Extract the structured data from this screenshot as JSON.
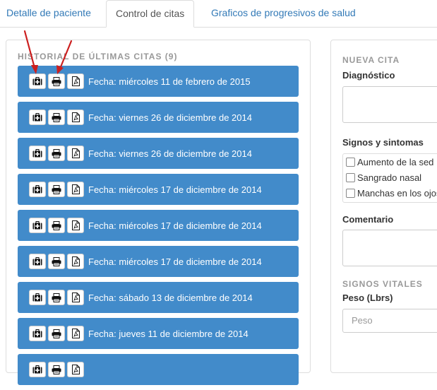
{
  "tabs": [
    {
      "label": "Detalle de paciente",
      "active": false
    },
    {
      "label": "Control de citas",
      "active": true
    },
    {
      "label": "Graficos de progresivos de salud",
      "active": false
    }
  ],
  "historial": {
    "title": "HISTORIAL DE ÚLTIMAS CITAS (9)",
    "citas": [
      {
        "fecha": "Fecha: miércoles 11 de febrero de 2015"
      },
      {
        "fecha": "Fecha: viernes 26 de diciembre de 2014"
      },
      {
        "fecha": "Fecha: viernes 26 de diciembre de 2014"
      },
      {
        "fecha": "Fecha: miércoles 17 de diciembre de 2014"
      },
      {
        "fecha": "Fecha: miércoles 17 de diciembre de 2014"
      },
      {
        "fecha": "Fecha: miércoles 17 de diciembre de 2014"
      },
      {
        "fecha": "Fecha: sábado 13 de diciembre de 2014"
      },
      {
        "fecha": "Fecha: jueves 11 de diciembre de 2014"
      },
      {
        "fecha": ""
      }
    ],
    "row_icons": [
      "medkit-icon",
      "print-icon",
      "pdf-icon"
    ]
  },
  "nueva_cita": {
    "title": "NUEVA CITA",
    "diagnostico_label": "Diagnóstico",
    "signos_label": "Signos y sintomas",
    "sintomas": [
      "Aumento de la sed",
      "Sangrado nasal",
      "Manchas en los ojos"
    ],
    "comentario_label": "Comentario",
    "signos_vitales_title": "SIGNOS VITALES",
    "peso_label": "Peso (Lbrs)",
    "peso_placeholder": "Peso"
  },
  "colors": {
    "row_bg": "#428bca",
    "link": "#337ab7",
    "annotation_arrow": "#cc1f1f"
  }
}
